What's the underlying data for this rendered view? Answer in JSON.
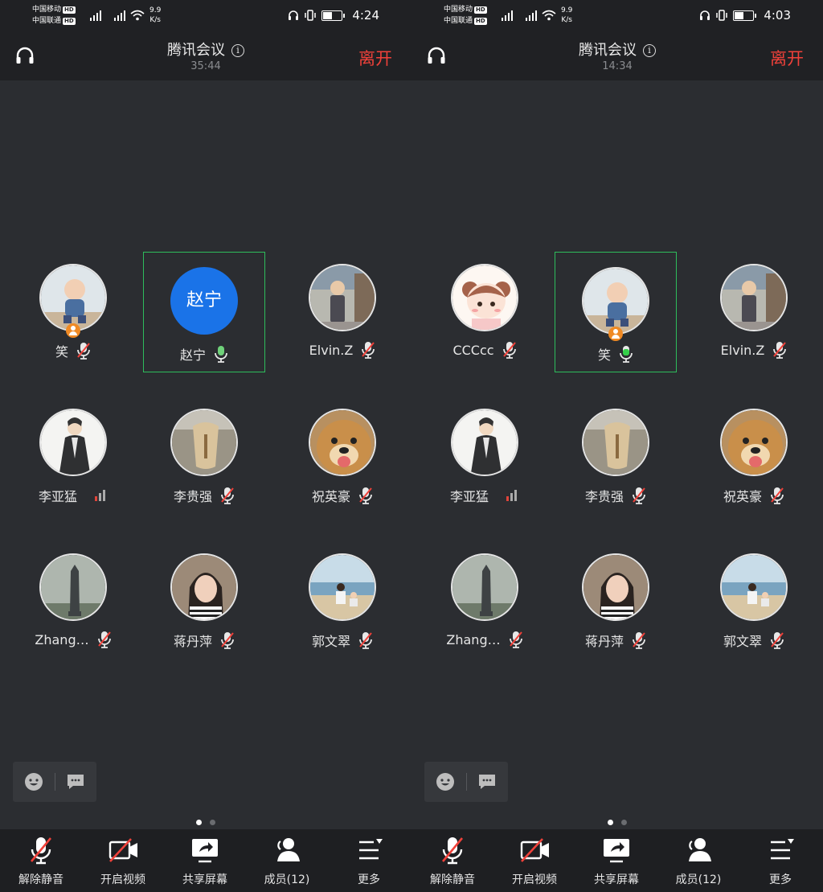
{
  "panels": [
    {
      "status": {
        "carrier1": "中国移动",
        "carrier2": "中国联通",
        "hd": "HD",
        "net_speed_value": "9.9",
        "net_speed_unit": "K/s",
        "time": "4:24"
      },
      "header": {
        "title": "腾讯会议",
        "duration": "35:44",
        "leave": "离开"
      },
      "participants": [
        {
          "name": "笑",
          "avatar": "baby-photo",
          "host": true,
          "mic": "muted",
          "active": false
        },
        {
          "name": "赵宁",
          "avatar_text": "赵宁",
          "avatar": "text",
          "host": false,
          "mic": "on",
          "active": true
        },
        {
          "name": "Elvin.Z",
          "avatar": "monk-photo",
          "host": false,
          "mic": "muted",
          "active": false
        },
        {
          "name": "李亚猛",
          "avatar": "robe-figure",
          "host": false,
          "mic": "signal",
          "active": false
        },
        {
          "name": "李贵强",
          "avatar": "carving-photo",
          "host": false,
          "mic": "muted",
          "active": false
        },
        {
          "name": "祝英豪",
          "avatar": "dog-photo",
          "host": false,
          "mic": "muted",
          "active": false
        },
        {
          "name": "Zhang…",
          "avatar": "pagoda-photo",
          "host": false,
          "mic": "muted",
          "active": false
        },
        {
          "name": "蒋丹萍",
          "avatar": "woman-photo",
          "host": false,
          "mic": "muted",
          "active": false
        },
        {
          "name": "郭文翠",
          "avatar": "beach-photo",
          "host": false,
          "mic": "muted",
          "active": false
        }
      ]
    },
    {
      "status": {
        "carrier1": "中国移动",
        "carrier2": "中国联通",
        "hd": "HD",
        "net_speed_value": "9.9",
        "net_speed_unit": "K/s",
        "time": "4:03"
      },
      "header": {
        "title": "腾讯会议",
        "duration": "14:34",
        "leave": "离开"
      },
      "participants": [
        {
          "name": "CCCcc",
          "avatar": "cartoon-girl",
          "host": false,
          "mic": "muted",
          "active": false
        },
        {
          "name": "笑",
          "avatar": "baby-photo",
          "host": true,
          "mic": "speaking",
          "active": true
        },
        {
          "name": "Elvin.Z",
          "avatar": "monk-photo",
          "host": false,
          "mic": "muted",
          "active": false
        },
        {
          "name": "李亚猛",
          "avatar": "robe-figure",
          "host": false,
          "mic": "signal",
          "active": false
        },
        {
          "name": "李贵强",
          "avatar": "carving-photo",
          "host": false,
          "mic": "muted",
          "active": false
        },
        {
          "name": "祝英豪",
          "avatar": "dog-photo",
          "host": false,
          "mic": "muted",
          "active": false
        },
        {
          "name": "Zhang…",
          "avatar": "pagoda-photo",
          "host": false,
          "mic": "muted",
          "active": false
        },
        {
          "name": "蒋丹萍",
          "avatar": "woman-photo",
          "host": false,
          "mic": "muted",
          "active": false
        },
        {
          "name": "郭文翠",
          "avatar": "beach-photo",
          "host": false,
          "mic": "muted",
          "active": false
        }
      ]
    }
  ],
  "toolbar": [
    {
      "label": "解除静音",
      "icon": "mic-muted-icon"
    },
    {
      "label": "开启视频",
      "icon": "video-off-icon"
    },
    {
      "label": "共享屏幕",
      "icon": "share-screen-icon"
    },
    {
      "label": "成员(12)",
      "icon": "members-icon"
    },
    {
      "label": "更多",
      "icon": "more-icon"
    }
  ],
  "colors": {
    "accent_red": "#f0413a",
    "active_border": "#2ebd5c",
    "avatar_blue": "#1a73e8",
    "host_badge": "#f08a24",
    "mic_on": "#6fd17a",
    "speaking": "#35d14a"
  }
}
